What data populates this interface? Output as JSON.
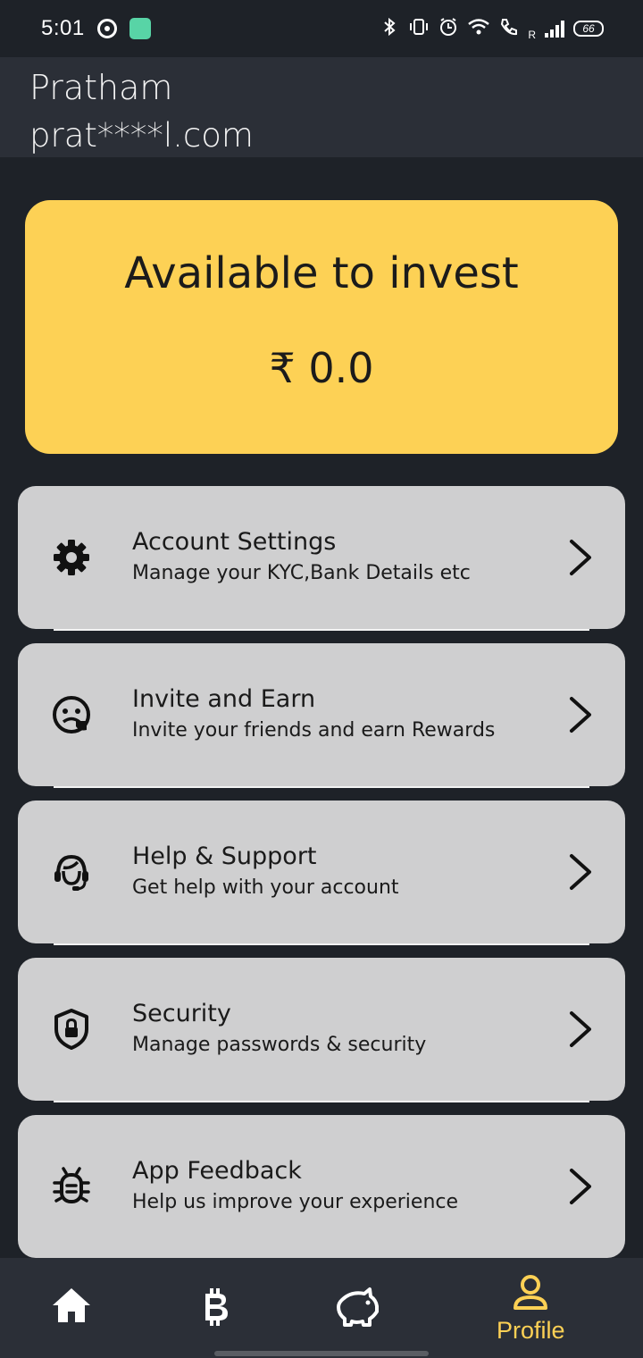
{
  "status_bar": {
    "time": "5:01",
    "battery": "66",
    "network_label": "R"
  },
  "header": {
    "name": "Pratham",
    "email": "prat****l.com"
  },
  "invest_card": {
    "title": "Available to invest",
    "amount": "₹ 0.0",
    "color": "#fdd155"
  },
  "menu": [
    {
      "title": "Account Settings",
      "subtitle": "Manage your KYC,Bank Details etc",
      "icon": "gear-icon"
    },
    {
      "title": "Invite and Earn",
      "subtitle": "Invite your friends and earn Rewards",
      "icon": "invite-face-icon"
    },
    {
      "title": "Help & Support",
      "subtitle": "Get help with your account",
      "icon": "headset-support-icon"
    },
    {
      "title": "Security",
      "subtitle": "Manage passwords & security",
      "icon": "shield-lock-icon"
    },
    {
      "title": "App Feedback",
      "subtitle": "Help us improve your experience",
      "icon": "bug-icon"
    }
  ],
  "bottom_nav": {
    "items": [
      {
        "icon": "home-icon",
        "label": ""
      },
      {
        "icon": "bitcoin-icon",
        "label": ""
      },
      {
        "icon": "piggy-bank-icon",
        "label": ""
      },
      {
        "icon": "profile-icon",
        "label": "Profile",
        "active": true
      }
    ],
    "active_color": "#fdd155"
  }
}
